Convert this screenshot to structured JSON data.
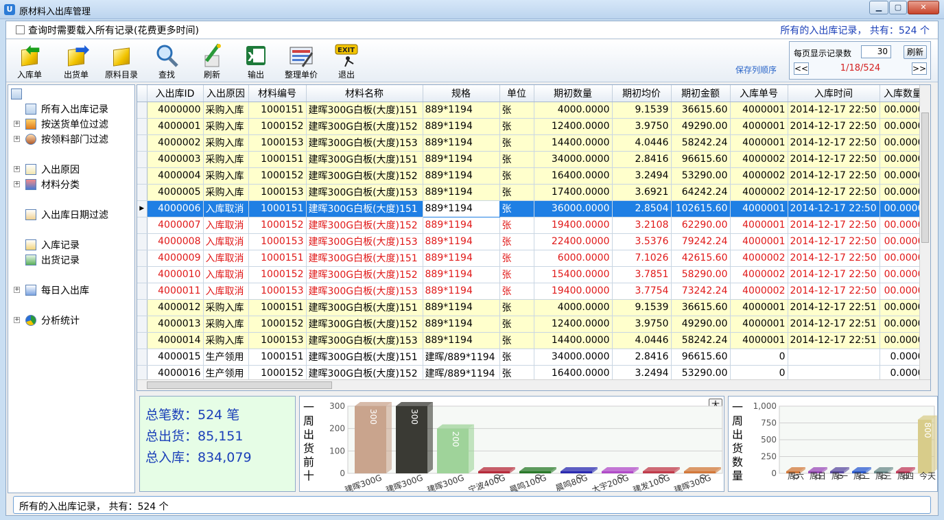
{
  "window": {
    "title": "原材料入出库管理",
    "icon": "app-icon"
  },
  "options": {
    "load_all_label": "查询时需要载入所有记录(花费更多时间)",
    "load_all_checked": false,
    "summary": "所有的入出库记录， 共有：524 个"
  },
  "toolbar": {
    "buttons": [
      {
        "label": "入库单",
        "icon": "stock-in-icon"
      },
      {
        "label": "出货单",
        "icon": "stock-out-icon"
      },
      {
        "label": "原料目录",
        "icon": "material-catalog-icon"
      },
      {
        "label": "查找",
        "icon": "search-icon"
      },
      {
        "label": "刷新",
        "icon": "refresh-icon"
      },
      {
        "label": "输出",
        "icon": "excel-export-icon"
      },
      {
        "label": "整理单价",
        "icon": "price-tidy-icon"
      },
      {
        "label": "退出",
        "icon": "exit-icon"
      }
    ],
    "save_columns": "保存列顺序"
  },
  "pager": {
    "label": "每页显示记录数",
    "per_page": "30",
    "refresh": "刷新",
    "prev": "<<",
    "next": ">>",
    "page_info": "1/18/524"
  },
  "tree": {
    "items": [
      {
        "label": "所有入出库记录",
        "icon": "table-icon"
      },
      {
        "label": "按送货单位过滤",
        "icon": "home-icon"
      },
      {
        "label": "按领料部门过滤",
        "icon": "person-icon"
      },
      {
        "label": "入出原因",
        "icon": "document-icon"
      },
      {
        "label": "材料分类",
        "icon": "category-icon"
      },
      {
        "label": "入出库日期过滤",
        "icon": "calendar-icon"
      },
      {
        "label": "入库记录",
        "icon": "record-in-icon"
      },
      {
        "label": "出货记录",
        "icon": "record-out-icon"
      },
      {
        "label": "每日入出库",
        "icon": "daily-icon"
      },
      {
        "label": "分析统计",
        "icon": "pie-chart-icon"
      }
    ]
  },
  "grid": {
    "columns": [
      "入出库ID",
      "入出原因",
      "材料编号",
      "材料名称",
      "规格",
      "单位",
      "期初数量",
      "期初均价",
      "期初金额",
      "入库单号",
      "入库时间",
      "入库数量"
    ],
    "rows": [
      {
        "style": "yellow",
        "cells": [
          "4000000",
          "采购入库",
          "1000151",
          "建晖300G白板(大度)151",
          "889*1194",
          "张",
          "4000.0000",
          "9.1539",
          "36615.60",
          "4000001",
          "2014-12-17 22:50",
          "00.0000"
        ]
      },
      {
        "style": "yellow",
        "cells": [
          "4000001",
          "采购入库",
          "1000152",
          "建晖300G白板(大度)152",
          "889*1194",
          "张",
          "12400.0000",
          "3.9750",
          "49290.00",
          "4000001",
          "2014-12-17 22:50",
          "00.0000"
        ]
      },
      {
        "style": "yellow",
        "cells": [
          "4000002",
          "采购入库",
          "1000153",
          "建晖300G白板(大度)153",
          "889*1194",
          "张",
          "14400.0000",
          "4.0446",
          "58242.24",
          "4000001",
          "2014-12-17 22:50",
          "00.0000"
        ]
      },
      {
        "style": "yellow",
        "cells": [
          "4000003",
          "采购入库",
          "1000151",
          "建晖300G白板(大度)151",
          "889*1194",
          "张",
          "34000.0000",
          "2.8416",
          "96615.60",
          "4000002",
          "2014-12-17 22:50",
          "00.0000"
        ]
      },
      {
        "style": "yellow",
        "cells": [
          "4000004",
          "采购入库",
          "1000152",
          "建晖300G白板(大度)152",
          "889*1194",
          "张",
          "16400.0000",
          "3.2494",
          "53290.00",
          "4000002",
          "2014-12-17 22:50",
          "00.0000"
        ]
      },
      {
        "style": "yellow",
        "cells": [
          "4000005",
          "采购入库",
          "1000153",
          "建晖300G白板(大度)153",
          "889*1194",
          "张",
          "17400.0000",
          "3.6921",
          "64242.24",
          "4000002",
          "2014-12-17 22:50",
          "00.0000"
        ]
      },
      {
        "style": "current",
        "cells": [
          "4000006",
          "入库取消",
          "1000151",
          "建晖300G白板(大度)151",
          "889*1194",
          "张",
          "36000.0000",
          "2.8504",
          "102615.60",
          "4000001",
          "2014-12-17 22:50",
          "00.0000"
        ]
      },
      {
        "style": "red",
        "cells": [
          "4000007",
          "入库取消",
          "1000152",
          "建晖300G白板(大度)152",
          "889*1194",
          "张",
          "19400.0000",
          "3.2108",
          "62290.00",
          "4000001",
          "2014-12-17 22:50",
          "00.0000"
        ]
      },
      {
        "style": "red",
        "cells": [
          "4000008",
          "入库取消",
          "1000153",
          "建晖300G白板(大度)153",
          "889*1194",
          "张",
          "22400.0000",
          "3.5376",
          "79242.24",
          "4000001",
          "2014-12-17 22:50",
          "00.0000"
        ]
      },
      {
        "style": "red",
        "cells": [
          "4000009",
          "入库取消",
          "1000151",
          "建晖300G白板(大度)151",
          "889*1194",
          "张",
          "6000.0000",
          "7.1026",
          "42615.60",
          "4000002",
          "2014-12-17 22:50",
          "00.0000"
        ]
      },
      {
        "style": "red",
        "cells": [
          "4000010",
          "入库取消",
          "1000152",
          "建晖300G白板(大度)152",
          "889*1194",
          "张",
          "15400.0000",
          "3.7851",
          "58290.00",
          "4000002",
          "2014-12-17 22:50",
          "00.0000"
        ]
      },
      {
        "style": "red",
        "cells": [
          "4000011",
          "入库取消",
          "1000153",
          "建晖300G白板(大度)153",
          "889*1194",
          "张",
          "19400.0000",
          "3.7754",
          "73242.24",
          "4000002",
          "2014-12-17 22:50",
          "00.0000"
        ]
      },
      {
        "style": "yellow",
        "cells": [
          "4000012",
          "采购入库",
          "1000151",
          "建晖300G白板(大度)151",
          "889*1194",
          "张",
          "4000.0000",
          "9.1539",
          "36615.60",
          "4000001",
          "2014-12-17 22:51",
          "00.0000"
        ]
      },
      {
        "style": "yellow",
        "cells": [
          "4000013",
          "采购入库",
          "1000152",
          "建晖300G白板(大度)152",
          "889*1194",
          "张",
          "12400.0000",
          "3.9750",
          "49290.00",
          "4000001",
          "2014-12-17 22:51",
          "00.0000"
        ]
      },
      {
        "style": "yellow",
        "cells": [
          "4000014",
          "采购入库",
          "1000153",
          "建晖300G白板(大度)153",
          "889*1194",
          "张",
          "14400.0000",
          "4.0446",
          "58242.24",
          "4000001",
          "2014-12-17 22:51",
          "00.0000"
        ]
      },
      {
        "style": "white",
        "cells": [
          "4000015",
          "生产领用",
          "1000151",
          "建晖300G白板(大度)151",
          "建晖/889*1194",
          "张",
          "34000.0000",
          "2.8416",
          "96615.60",
          "0",
          "",
          "0.0000"
        ]
      },
      {
        "style": "white",
        "cells": [
          "4000016",
          "生产领用",
          "1000152",
          "建晖300G白板(大度)152",
          "建晖/889*1194",
          "张",
          "16400.0000",
          "3.2494",
          "53290.00",
          "0",
          "",
          "0.0000"
        ]
      }
    ]
  },
  "stats": {
    "total_count": "总笔数：524 笔",
    "total_out": "总出货：85,151",
    "total_in": "总入库：834,079"
  },
  "chart_data": [
    {
      "type": "bar",
      "title": "一周出货前十",
      "big_label": "大",
      "categories": [
        "建晖300G",
        "建晖300G",
        "建晖300G",
        "宁波400G",
        "晨鸣100G",
        "晨鸣80G",
        "大宇200G",
        "建发100G",
        "建晖300G"
      ],
      "values": [
        300,
        300,
        200,
        0,
        0,
        0,
        0,
        0,
        0
      ],
      "colors": [
        "#c9a48d",
        "#3a3a34",
        "#9fd39a",
        "#b52a3a",
        "#2a7a2a",
        "#2a2ab0",
        "#b04ac8",
        "#c03a4a",
        "#d2783a"
      ],
      "yticks": [
        "0",
        "100",
        "200",
        "300"
      ],
      "ylim": [
        0,
        300
      ]
    },
    {
      "type": "bar",
      "title": "一周出货数量",
      "categories": [
        "周六",
        "周日",
        "周一",
        "周二",
        "周三",
        "周四",
        "今天"
      ],
      "values": [
        0,
        0,
        0,
        0,
        0,
        0,
        800
      ],
      "colors": [
        "#d2783a",
        "#9a4ab8",
        "#5a4aa0",
        "#2a5ad0",
        "#6a8a8a",
        "#c03a5a",
        "#d8cc8a"
      ],
      "yticks": [
        "0",
        "250",
        "500",
        "750",
        "1,000"
      ],
      "ylim": [
        0,
        1000
      ]
    }
  ],
  "status": {
    "text": "所有的入出库记录， 共有：524 个"
  }
}
